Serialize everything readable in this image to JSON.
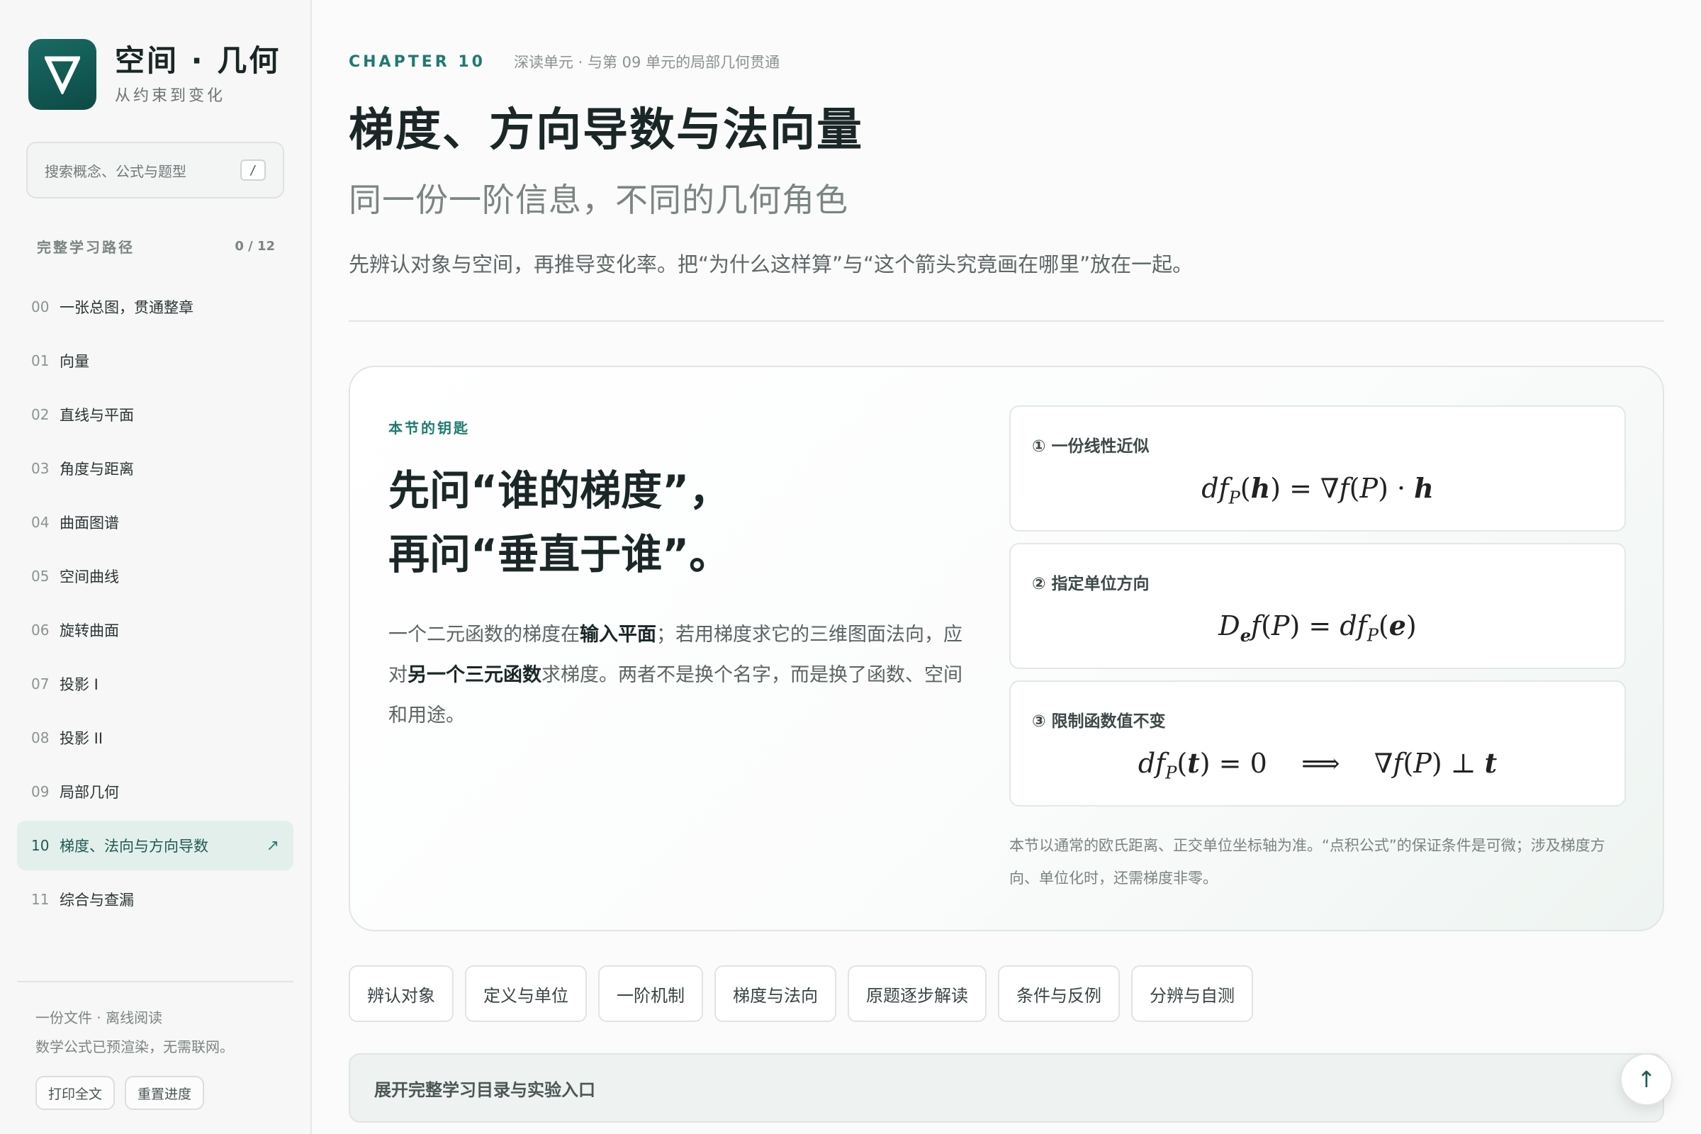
{
  "sidebar": {
    "brand": {
      "title": "空间 · 几何",
      "subtitle": "从约束到变化"
    },
    "search": {
      "placeholder": "搜索概念、公式与题型",
      "shortcut": "/"
    },
    "path": {
      "title": "完整学习路径",
      "count": "0 / 12"
    },
    "items": [
      {
        "num": "00",
        "label": "一张总图，贯通整章"
      },
      {
        "num": "01",
        "label": "向量"
      },
      {
        "num": "02",
        "label": "直线与平面"
      },
      {
        "num": "03",
        "label": "角度与距离"
      },
      {
        "num": "04",
        "label": "曲面图谱"
      },
      {
        "num": "05",
        "label": "空间曲线"
      },
      {
        "num": "06",
        "label": "旋转曲面"
      },
      {
        "num": "07",
        "label": "投影 I"
      },
      {
        "num": "08",
        "label": "投影 II"
      },
      {
        "num": "09",
        "label": "局部几何"
      },
      {
        "num": "10",
        "label": "梯度、法向与方向导数",
        "active": true,
        "arrow": "↗"
      },
      {
        "num": "11",
        "label": "综合与查漏"
      }
    ],
    "footer": {
      "line1": "一份文件 · 离线阅读",
      "line2": "数学公式已预渲染，无需联网。",
      "print_label": "打印全文",
      "reset_label": "重置进度"
    }
  },
  "main": {
    "chapter_tag": "CHAPTER 10",
    "chapter_note": "深读单元 · 与第 09 单元的局部几何贯通",
    "title": "梯度、方向导数与法向量",
    "subtitle": "同一份一阶信息，不同的几何角色",
    "lead": "先辨认对象与空间，再推导变化率。把“为什么这样算”与“这个箭头究竟画在哪里”放在一起。",
    "hero": {
      "kicker": "本节的钥匙",
      "heading_line1": "先问“谁的梯度”，",
      "heading_line2": "再问“垂直于谁”。",
      "body_p1": "一个二元函数的梯度在",
      "body_b1": "输入平面",
      "body_p2": "；若用梯度求它的三维图面法向，应对",
      "body_b2": "另一个三元函数",
      "body_p3": "求梯度。两者不是换个名字，而是换了函数、空间和用途。",
      "note": "本节以通常的欧氏距离、正交单位坐标轴为准。“点积公式”的保证条件是可微；涉及梯度方向、单位化时，还需梯度非零。"
    },
    "cards": [
      {
        "title": "① 一份线性近似",
        "formula": "df_P(h) = ∇f(P) · h"
      },
      {
        "title": "② 指定单位方向",
        "formula": "D_e f(P) = df_P(e)"
      },
      {
        "title": "③ 限制函数值不变",
        "formula": "df_P(t) = 0 ⟹ ∇f(P) ⊥ t"
      }
    ],
    "pills": [
      "辨认对象",
      "定义与单位",
      "一阶机制",
      "梯度与法向",
      "原题逐步解读",
      "条件与反例",
      "分辨与自测"
    ],
    "expand_label": "展开完整学习目录与实验入口",
    "back_to_top": "↑"
  },
  "colors": {
    "accent": "#1f7a70",
    "brand_dark": "#0d4a46",
    "active_bg": "#e3efea"
  },
  "icons": {
    "logo": "nabla-logo-icon",
    "arrow": "external-arrow-icon",
    "top": "arrow-up-icon"
  }
}
